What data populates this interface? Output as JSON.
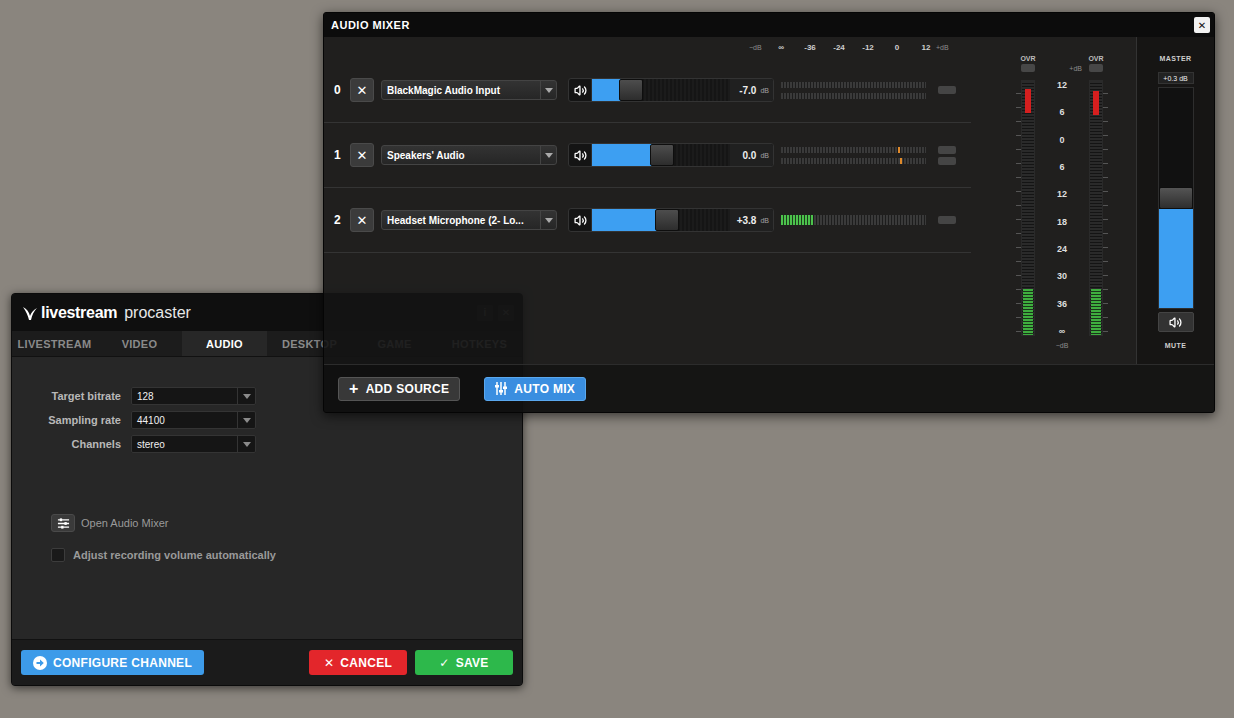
{
  "procaster": {
    "logo": {
      "brand": "livestream",
      "product": "procaster"
    },
    "title_buttons": [
      "i",
      "✕"
    ],
    "tabs": [
      {
        "label": "LIVESTREAM",
        "selected": false
      },
      {
        "label": "VIDEO",
        "selected": false
      },
      {
        "label": "AUDIO",
        "selected": true
      },
      {
        "label": "DESKTOP",
        "selected": false
      },
      {
        "label": "GAME",
        "selected": false
      },
      {
        "label": "HOTKEYS",
        "selected": false
      }
    ],
    "fields": [
      {
        "label": "Target bitrate",
        "value": "128"
      },
      {
        "label": "Sampling rate",
        "value": "44100"
      },
      {
        "label": "Channels",
        "value": "stereo"
      }
    ],
    "mixer_link": "Open Audio Mixer",
    "auto_volume": {
      "label": "Adjust recording volume automatically",
      "checked": false
    },
    "buttons": [
      {
        "label": "CONFIGURE CHANNEL",
        "kind": "arrow",
        "color": "#3d9be9"
      },
      {
        "label": "CANCEL",
        "kind": "glyph",
        "glyph": "✕",
        "color": "#e3262b"
      },
      {
        "label": "SAVE",
        "kind": "glyph",
        "glyph": "✓",
        "color": "#2db84b"
      }
    ]
  },
  "mixer": {
    "title": "AUDIO MIXER",
    "close": "✕",
    "scale": {
      "low": "−dB",
      "ticks": [
        "∞",
        "-36",
        "-24",
        "-12",
        "0",
        "12"
      ],
      "high": "+dB"
    },
    "channels": [
      {
        "index": "0",
        "remove": "✕",
        "source": "BlackMagic Audio Input",
        "level": 0.28,
        "reading": "-7.0",
        "unit": "dB",
        "meters": [
          {
            "level": 0,
            "peak": 0
          },
          {
            "level": 0,
            "peak": 0
          }
        ],
        "side_buttons": [
          {
            "on": false
          }
        ]
      },
      {
        "index": "1",
        "remove": "✕",
        "source": "Speakers' Audio",
        "level": 0.51,
        "reading": "0.0",
        "unit": "dB",
        "meters": [
          {
            "level": 0,
            "peak": 0.81
          },
          {
            "level": 0,
            "peak": 0.82
          }
        ],
        "side_buttons": [
          {
            "on": false
          },
          {
            "on": false
          }
        ]
      },
      {
        "index": "2",
        "remove": "✕",
        "source": "Headset Microphone (2- Lo...",
        "level": 0.54,
        "reading": "+3.8",
        "unit": "dB",
        "meters": [
          {
            "level": 0.22,
            "peak": 0
          }
        ],
        "side_buttons": [
          {
            "on": false
          }
        ]
      }
    ],
    "vu": {
      "ovr": [
        {
          "label": "OVR",
          "on": false
        },
        {
          "label": "OVR",
          "on": false
        }
      ],
      "high": "+dB",
      "scale": [
        "12",
        "6",
        "0",
        "6",
        "12",
        "18",
        "24",
        "30",
        "36",
        "∞"
      ],
      "low": "−dB",
      "meters": [
        {
          "level": 0.18,
          "peak": 0.97
        },
        {
          "level": 0.18,
          "peak": 0.96
        }
      ]
    },
    "master": {
      "label": "MASTER",
      "reading": "+0.3",
      "unit": "dB",
      "level": 0.45,
      "muted": false,
      "mute_label": "MUTE"
    },
    "buttons": [
      {
        "label": "ADD SOURCE",
        "glyph": "+",
        "selected": false
      },
      {
        "label": "AUTO MIX",
        "selected": true
      }
    ]
  }
}
